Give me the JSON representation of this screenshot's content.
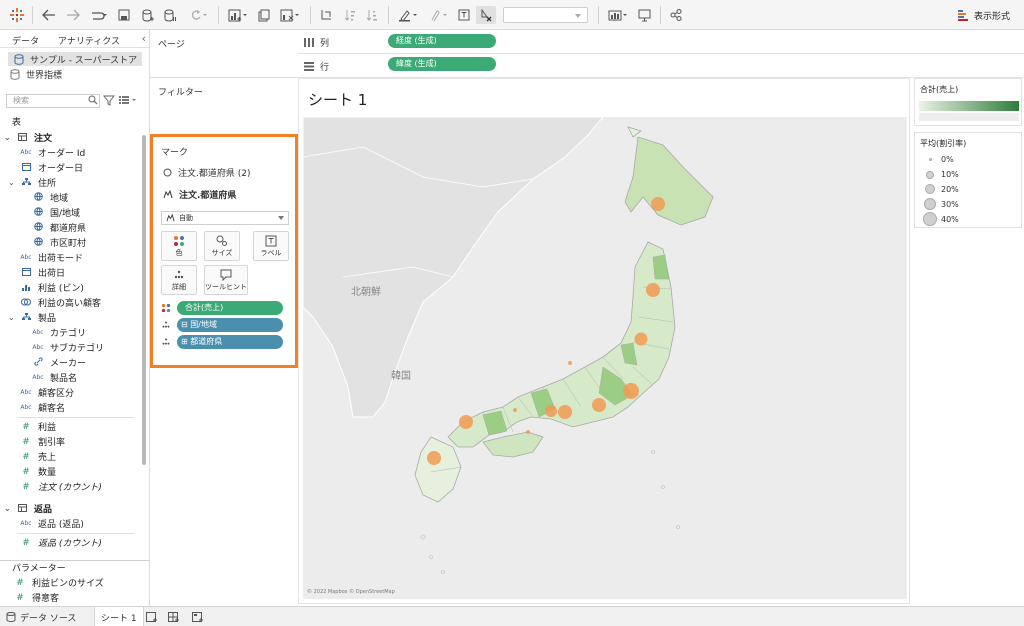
{
  "toolbar": {
    "show_me_label": "表示形式"
  },
  "data_pane": {
    "tabs": [
      "データ",
      "アナリティクス"
    ],
    "datasources": [
      "サンプル - スーパーストア",
      "世界指標"
    ],
    "search_placeholder": "検索",
    "section_label": "表",
    "tables": [
      {
        "name": "注文",
        "dimensions": [
          {
            "type": "Abc",
            "name": "オーダー Id",
            "indent": 1
          },
          {
            "type": "date",
            "name": "オーダー日",
            "indent": 1
          },
          {
            "type": "hier",
            "name": "住所",
            "indent": 1
          },
          {
            "type": "geo",
            "name": "地域",
            "indent": 2
          },
          {
            "type": "geo",
            "name": "国/地域",
            "indent": 2
          },
          {
            "type": "geo",
            "name": "都道府県",
            "indent": 2
          },
          {
            "type": "geo",
            "name": "市区町村",
            "indent": 2
          },
          {
            "type": "Abc",
            "name": "出荷モード",
            "indent": 1
          },
          {
            "type": "date",
            "name": "出荷日",
            "indent": 1
          },
          {
            "type": "bin",
            "name": "利益 (ビン)",
            "indent": 1
          },
          {
            "type": "set",
            "name": "利益の高い顧客",
            "indent": 1
          },
          {
            "type": "hier",
            "name": "製品",
            "indent": 1
          },
          {
            "type": "Abc",
            "name": "カテゴリ",
            "indent": 2
          },
          {
            "type": "Abc",
            "name": "サブカテゴリ",
            "indent": 2
          },
          {
            "type": "link",
            "name": "メーカー",
            "indent": 2
          },
          {
            "type": "Abc",
            "name": "製品名",
            "indent": 2
          },
          {
            "type": "Abc",
            "name": "顧客区分",
            "indent": 1
          },
          {
            "type": "Abc",
            "name": "顧客名",
            "indent": 1
          }
        ],
        "measures": [
          "利益",
          "割引率",
          "売上",
          "数量",
          "注文 (カウント)"
        ]
      },
      {
        "name": "返品",
        "dimensions": [
          {
            "type": "Abc",
            "name": "返品 (返品)",
            "indent": 1
          }
        ],
        "measures": [
          "返品 (カウント)"
        ]
      }
    ],
    "parameters_label": "パラメーター",
    "parameters": [
      "利益ビンのサイズ",
      "得意客"
    ]
  },
  "shelves": {
    "pages_label": "ページ",
    "filters_label": "フィルター",
    "columns_label": "列",
    "rows_label": "行",
    "columns_pill": "経度 (生成)",
    "rows_pill": "緯度 (生成)"
  },
  "marks": {
    "title": "マーク",
    "layers": [
      "注文.都道府県 (2)",
      "注文.都道府県"
    ],
    "mark_type": "自動",
    "buttons": [
      "色",
      "サイズ",
      "ラベル",
      "詳細",
      "ツールヒント"
    ],
    "pills": [
      {
        "label": "合計(売上)",
        "color": "#3caa77"
      },
      {
        "label": "国/地域",
        "color": "#4a8fae"
      },
      {
        "label": "都道府県",
        "color": "#4a8fae"
      }
    ]
  },
  "sheet": {
    "title": "シート 1",
    "map_labels": [
      "北朝鮮",
      "韓国"
    ],
    "credit": "© 2022 Mapbox © OpenStreetMap"
  },
  "legends": {
    "color_title": "合計(売上)",
    "color_from": "#eaf3e4",
    "color_to": "#2e7d3a",
    "size_title": "平均(割引率)",
    "size_items": [
      "0%",
      "10%",
      "20%",
      "30%",
      "40%"
    ]
  },
  "bottom_tabs": {
    "datasource": "データ ソース",
    "sheet": "シート 1"
  },
  "colors": {
    "accent_orange": "#f08125",
    "pill_green": "#3caa77",
    "pill_blue": "#4a8fae"
  }
}
